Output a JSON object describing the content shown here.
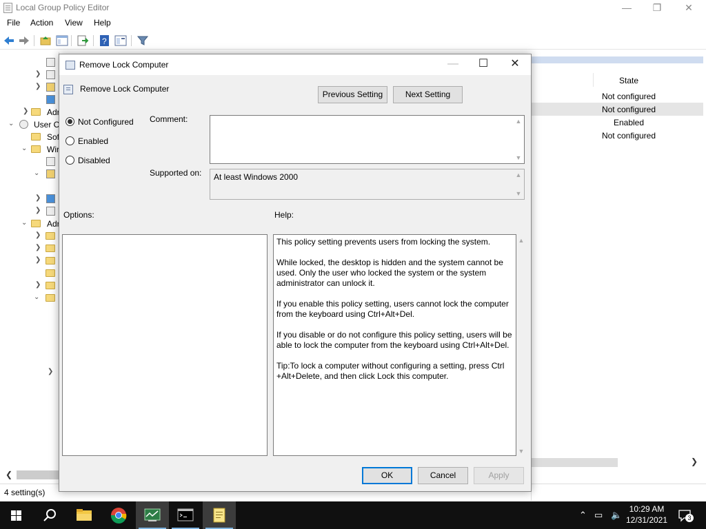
{
  "window": {
    "title": "Local Group Policy Editor",
    "menu": [
      "File",
      "Action",
      "View",
      "Help"
    ]
  },
  "tree": {
    "items": [
      {
        "label": "Adr"
      },
      {
        "label": "User Co"
      },
      {
        "label": "Sof"
      },
      {
        "label": "Wir"
      },
      {
        "label": "Adr"
      }
    ]
  },
  "details": {
    "state_header": "State",
    "states": [
      "Not configured",
      "Not configured",
      "Enabled",
      "Not configured"
    ]
  },
  "status": {
    "text": "4 setting(s)"
  },
  "dialog": {
    "title": "Remove Lock Computer",
    "header": "Remove Lock Computer",
    "prev_button": "Previous Setting",
    "next_button": "Next Setting",
    "radio_options": [
      "Not Configured",
      "Enabled",
      "Disabled"
    ],
    "selected_option": "Not Configured",
    "comment_label": "Comment:",
    "comment_value": "",
    "supported_label": "Supported on:",
    "supported_value": "At least Windows 2000",
    "options_label": "Options:",
    "help_label": "Help:",
    "help_paragraphs": [
      "This policy setting prevents users from locking the system.",
      "While locked, the desktop is hidden and the system cannot be used. Only the user who locked the system or the system administrator can unlock it.",
      "If you enable this policy setting, users cannot lock the computer from the keyboard using Ctrl+Alt+Del.",
      "If you disable or do not configure this policy setting, users will be able to lock the computer from the keyboard using Ctrl+Alt+Del.",
      "Tip:To lock a computer without configuring a setting, press Ctrl +Alt+Delete, and then click Lock this computer."
    ],
    "ok_button": "OK",
    "cancel_button": "Cancel",
    "apply_button": "Apply"
  },
  "taskbar": {
    "time": "10:29 AM",
    "date": "12/31/2021",
    "notification_count": "3",
    "apps": [
      "start-icon",
      "search-icon",
      "file-explorer-icon",
      "chrome-icon",
      "task-manager-icon",
      "terminal-icon",
      "notepad-icon"
    ]
  },
  "colors": {
    "accent": "#0078d7",
    "taskbar": "#101010",
    "selection": "#e5e5e5"
  }
}
